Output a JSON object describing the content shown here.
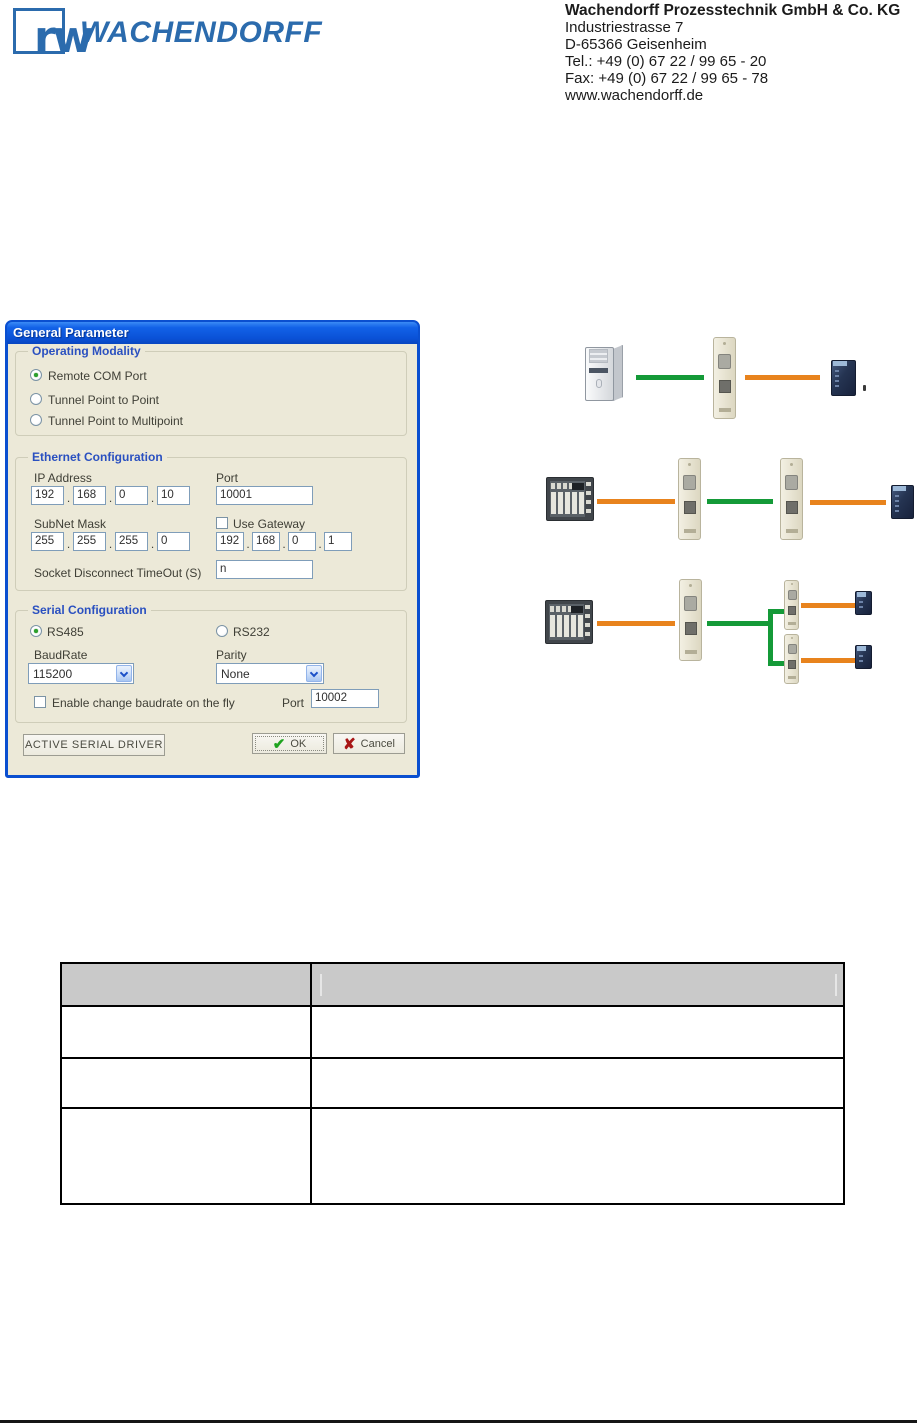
{
  "header": {
    "logo": {
      "mark": "rw",
      "text": "WACHENDORFF"
    },
    "contact": {
      "company": "Wachendorff Prozesstechnik GmbH & Co. KG",
      "street": "Industriestrasse 7",
      "city": "D-65366 Geisenheim",
      "tel": "Tel.: +49 (0) 67 22 / 99 65 - 20",
      "fax": "Fax: +49 (0) 67 22 / 99 65 - 78",
      "web": "www.wachendorff.de"
    }
  },
  "dialog": {
    "title": "General Parameter",
    "operating_modality": {
      "label": "Operating Modality",
      "options": [
        {
          "label": "Remote COM Port",
          "selected": true
        },
        {
          "label": "Tunnel Point to Point",
          "selected": false
        },
        {
          "label": "Tunnel Point to Multipoint",
          "selected": false
        }
      ]
    },
    "ethernet": {
      "label": "Ethernet Configuration",
      "ip_address": {
        "label": "IP Address",
        "octets": [
          "192",
          "168",
          "0",
          "10"
        ]
      },
      "port": {
        "label": "Port",
        "value": "10001"
      },
      "subnet_mask": {
        "label": "SubNet Mask",
        "octets": [
          "255",
          "255",
          "255",
          "0"
        ]
      },
      "gateway": {
        "label": "Use Gateway",
        "checked": false,
        "octets": [
          "192",
          "168",
          "0",
          "1"
        ]
      },
      "timeout": {
        "label": "Socket Disconnect TimeOut (S)",
        "value": "n"
      }
    },
    "serial": {
      "label": "Serial Configuration",
      "rs485": {
        "label": "RS485",
        "selected": true
      },
      "rs232": {
        "label": "RS232",
        "selected": false
      },
      "baudrate": {
        "label": "BaudRate",
        "value": "115200"
      },
      "parity": {
        "label": "Parity",
        "value": "None"
      },
      "fly": {
        "label": "Enable change baudrate on the fly",
        "checked": false
      },
      "port": {
        "label": "Port",
        "value": "10002"
      }
    },
    "buttons": {
      "driver": "ACTIVE SERIAL DRIVER",
      "ok": "OK",
      "cancel": "Cancel"
    }
  },
  "diagrams": {
    "stray_mark": "",
    "scenario1": {
      "devices": [
        "pc-tower",
        "serial-ethernet-converter",
        "field-device"
      ],
      "links": [
        "green",
        "orange"
      ]
    },
    "scenario2": {
      "devices": [
        "hmi-panel",
        "serial-ethernet-converter",
        "serial-ethernet-converter",
        "field-device"
      ],
      "links": [
        "orange",
        "green",
        "orange"
      ]
    },
    "scenario3": {
      "devices": [
        "hmi-panel",
        "serial-ethernet-converter",
        "serial-ethernet-converter",
        "serial-ethernet-converter",
        "field-device",
        "field-device"
      ],
      "links": [
        "orange",
        "green-branch",
        "orange",
        "orange"
      ]
    }
  },
  "colors": {
    "logo_blue": "#2b6bad",
    "titlebar_blue": "#0a51d6",
    "dialog_face": "#ece9d8",
    "group_label_blue": "#2a50c0",
    "link_green": "#149a38",
    "link_orange": "#e8831d",
    "table_header_gray": "#c9c9c9"
  },
  "table": {
    "header": [
      "",
      ""
    ],
    "rows": [
      [
        "",
        ""
      ],
      [
        "",
        ""
      ],
      [
        "",
        ""
      ]
    ]
  }
}
